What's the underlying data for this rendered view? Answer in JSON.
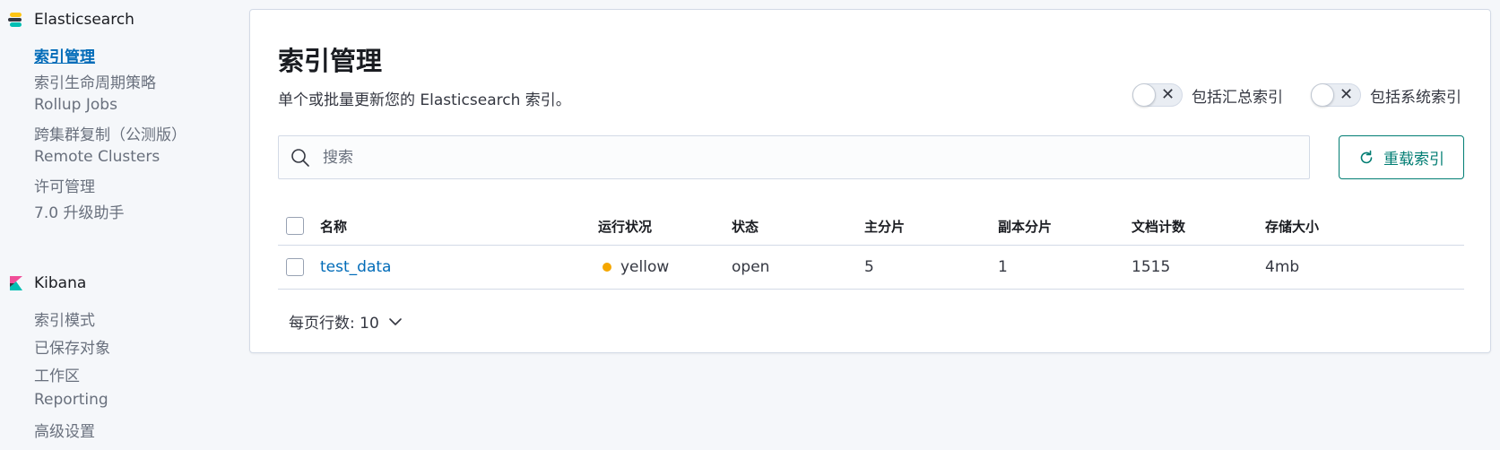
{
  "sidebar": {
    "elasticsearch": {
      "title": "Elasticsearch",
      "items": [
        {
          "label": "索引管理",
          "active": true
        },
        {
          "label": "索引生命周期策略"
        },
        {
          "label": "Rollup Jobs"
        },
        {
          "label": "跨集群复制（公测版）"
        },
        {
          "label": "Remote Clusters"
        },
        {
          "label": "许可管理"
        },
        {
          "label": "7.0 升级助手"
        }
      ]
    },
    "kibana": {
      "title": "Kibana",
      "items": [
        {
          "label": "索引模式"
        },
        {
          "label": "已保存对象"
        },
        {
          "label": "工作区"
        },
        {
          "label": "Reporting"
        },
        {
          "label": "高级设置"
        }
      ]
    }
  },
  "main": {
    "title": "索引管理",
    "description": "单个或批量更新您的 Elasticsearch 索引。",
    "toggles": [
      {
        "label": "包括汇总索引",
        "on": false
      },
      {
        "label": "包括系统索引",
        "on": false
      }
    ],
    "search": {
      "placeholder": "搜索",
      "value": ""
    },
    "reload_button": "重载索引",
    "table": {
      "headers": [
        "名称",
        "运行状况",
        "状态",
        "主分片",
        "副本分片",
        "文档计数",
        "存储大小"
      ],
      "rows": [
        {
          "name": "test_data",
          "health": "yellow",
          "status": "open",
          "primaries": "5",
          "replicas": "1",
          "docs": "1515",
          "size": "4mb"
        }
      ]
    },
    "pagination": {
      "label": "每页行数: 10"
    }
  },
  "colors": {
    "accent": "#006bb8",
    "health_yellow": "#f5a700",
    "button_teal": "#017d73"
  }
}
